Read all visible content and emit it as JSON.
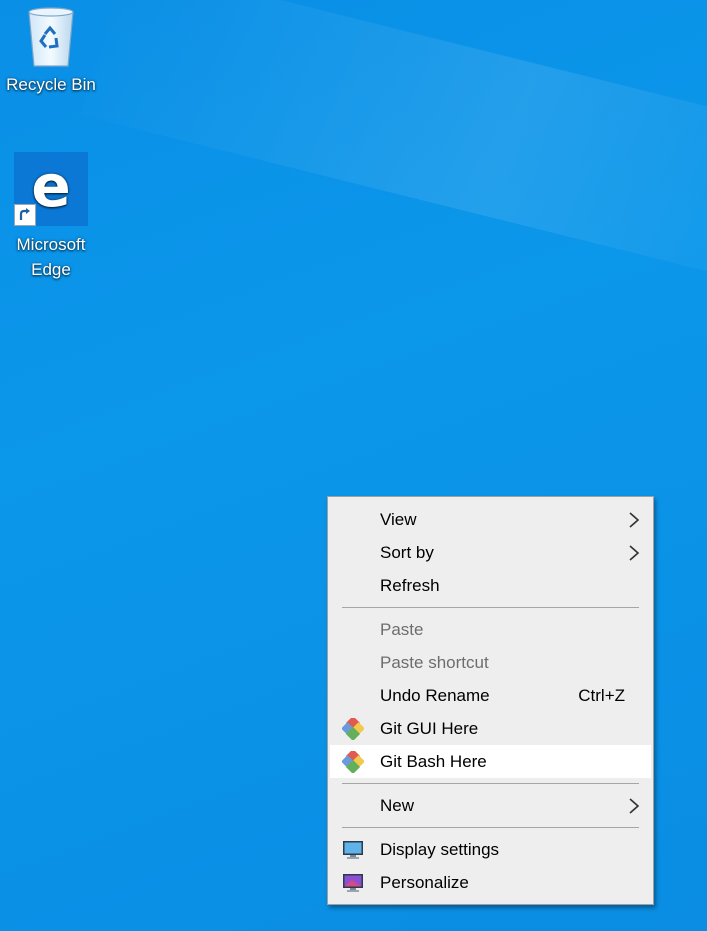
{
  "desktop": {
    "icons": [
      {
        "label": "Recycle Bin",
        "icon": "recycle-bin-icon"
      },
      {
        "label_line1": "Microsoft",
        "label_line2": "Edge",
        "icon": "edge-icon"
      }
    ],
    "colors": {
      "background": "#0b93e8",
      "menu_bg": "#eeeeee",
      "hover_bg": "#ffffff"
    }
  },
  "context_menu": {
    "items": [
      {
        "label": "View",
        "submenu": true
      },
      {
        "label": "Sort by",
        "submenu": true
      },
      {
        "label": "Refresh"
      },
      {
        "label": "Paste",
        "disabled": true
      },
      {
        "label": "Paste shortcut",
        "disabled": true
      },
      {
        "label": "Undo Rename",
        "shortcut": "Ctrl+Z"
      },
      {
        "label": "Git GUI Here",
        "icon": "git-icon"
      },
      {
        "label": "Git Bash Here",
        "icon": "git-icon",
        "highlighted": true
      },
      {
        "label": "New",
        "submenu": true
      },
      {
        "label": "Display settings",
        "icon": "monitor-icon"
      },
      {
        "label": "Personalize",
        "icon": "personalize-icon"
      }
    ]
  }
}
